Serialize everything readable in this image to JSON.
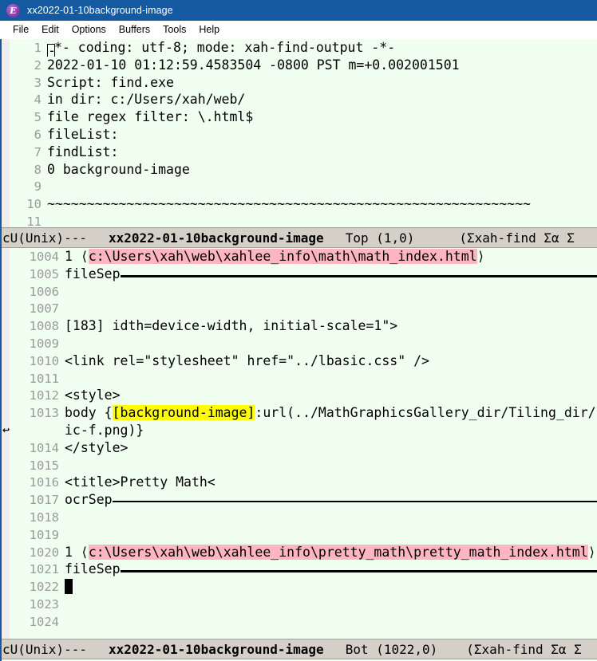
{
  "window": {
    "title": "xx2022-01-10background-image",
    "icon": "emacs-icon",
    "icon_letter": "E",
    "titlebar_color": "#1559a1"
  },
  "menubar": {
    "items": [
      {
        "label": "File"
      },
      {
        "label": "Edit"
      },
      {
        "label": "Options"
      },
      {
        "label": "Buffers"
      },
      {
        "label": "Tools"
      },
      {
        "label": "Help"
      }
    ]
  },
  "colors": {
    "background": "#f0fff0",
    "fringe": "#efeff0",
    "modeline": "#d4d0c8",
    "highlight_pink": "#ffb6c1",
    "highlight_yellow": "#ffff00",
    "line_number": "#9a9a9a"
  },
  "top_pane": {
    "lines": [
      {
        "num": "1",
        "text": "*- coding: utf-8; mode: xah-find-output -*-",
        "cursor": "box",
        "cursor_char": "-"
      },
      {
        "num": "2",
        "text": "2022-01-10 01:12:59.4583504 -0800 PST m=+0.002001501"
      },
      {
        "num": "3",
        "text": "Script: find.exe"
      },
      {
        "num": "4",
        "text": "in dir: c:/Users/xah/web/"
      },
      {
        "num": "5",
        "text": "file regex filter: \\.html$"
      },
      {
        "num": "6",
        "text": "fileList:"
      },
      {
        "num": "7",
        "text": "findList:"
      },
      {
        "num": "8",
        "text": "0 background-image"
      },
      {
        "num": "9",
        "text": ""
      },
      {
        "num": "10",
        "text": "~~~~~~~~~~~~~~~~~~~~~~~~~~~~~~~~~~~~~~~~~~~~~~~~~~~~~~~~~~~~~"
      },
      {
        "num": "11",
        "text": ""
      }
    ]
  },
  "top_modeline": {
    "coding": "cU(Unix)---",
    "buffer": "xx2022-01-10background-image",
    "position": "Top (1,0)",
    "modes": "(Σxah-find Σα Σ"
  },
  "bottom_pane": {
    "lines": [
      {
        "num": "1004",
        "prefix": "1 ⟨",
        "highlight": "pink",
        "highlighted": "c:\\Users\\xah\\web\\xahlee_info\\math\\math_index.html",
        "suffix": "⟩"
      },
      {
        "num": "1005",
        "text": "fileSep",
        "rule": "thick"
      },
      {
        "num": "1006",
        "text": ""
      },
      {
        "num": "1007",
        "text": ""
      },
      {
        "num": "1008",
        "text": "[183] idth=device-width, initial-scale=1\">"
      },
      {
        "num": "1009",
        "text": ""
      },
      {
        "num": "1010",
        "text": "<link rel=\"stylesheet\" href=\"../lbasic.css\" />"
      },
      {
        "num": "1011",
        "text": ""
      },
      {
        "num": "1012",
        "text": "<style>"
      },
      {
        "num": "1013",
        "prefix": "body {",
        "highlight": "yellow",
        "highlighted": "[background-image]",
        "suffix": ":url(../MathGraphicsGallery_dir/Tiling_dir/im",
        "wrap": "ic-f.png)}"
      },
      {
        "num": "1014",
        "text": "</style>"
      },
      {
        "num": "1015",
        "text": ""
      },
      {
        "num": "1016",
        "text": "<title>Pretty Math<"
      },
      {
        "num": "1017",
        "text": "ocrSep",
        "rule": "thin"
      },
      {
        "num": "1018",
        "text": ""
      },
      {
        "num": "1019",
        "text": ""
      },
      {
        "num": "1020",
        "prefix": "1 ⟨",
        "highlight": "pink",
        "highlighted": "c:\\Users\\xah\\web\\xahlee_info\\pretty_math\\pretty_math_index.html",
        "suffix": "⟩"
      },
      {
        "num": "1021",
        "text": "fileSep",
        "rule": "thick"
      },
      {
        "num": "1022",
        "text": "",
        "cursor": "block"
      },
      {
        "num": "1023",
        "text": ""
      },
      {
        "num": "1024",
        "text": ""
      }
    ],
    "continuation_glyph": "↩"
  },
  "bottom_modeline": {
    "coding": "cU(Unix)---",
    "buffer": "xx2022-01-10background-image",
    "position": "Bot (1022,0)",
    "modes": "(Σxah-find Σα Σ"
  }
}
